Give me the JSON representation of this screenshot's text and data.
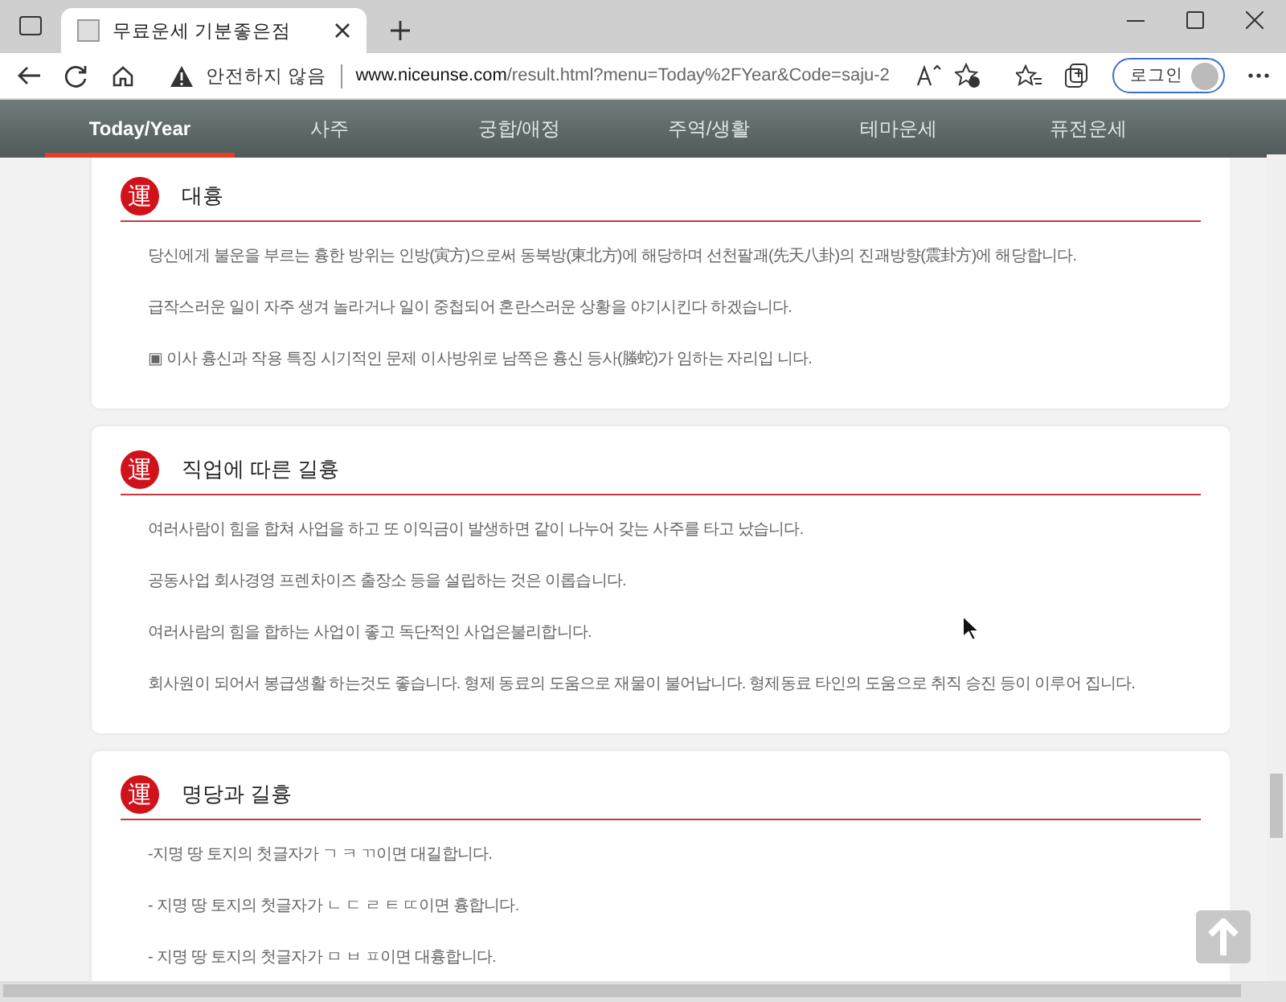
{
  "browser": {
    "tab_title": "무료운세 기분좋은점",
    "security_label": "안전하지 않음",
    "url_host": "www.niceunse.com",
    "url_path": "/result.html?menu=Today%2FYear&Code=saju-2",
    "login_label": "로그인"
  },
  "nav": [
    {
      "label": "Today/Year",
      "selected": true
    },
    {
      "label": "사주",
      "selected": false
    },
    {
      "label": "궁합/애정",
      "selected": false
    },
    {
      "label": "주역/생활",
      "selected": false
    },
    {
      "label": "테마운세",
      "selected": false
    },
    {
      "label": "퓨전운세",
      "selected": false
    }
  ],
  "sections": [
    {
      "badge": "運",
      "title": "대흉",
      "paragraphs": [
        "당신에게 불운을 부르는 흉한 방위는 인방(寅方)으로써 동북방(東北方)에 해당하며 선천팔괘(先天八卦)의 진괘방향(震卦方)에 해당합니다.",
        "급작스러운 일이 자주 생겨 놀라거나 일이 중첩되어 혼란스러운 상황을 야기시킨다 하겠습니다.",
        "▣ 이사 흉신과 작용 특징 시기적인 문제 이사방위로 남쪽은 흉신 등사(螣蛇)가 임하는 자리입 니다."
      ]
    },
    {
      "badge": "運",
      "title": "직업에 따른 길흉",
      "paragraphs": [
        "여러사람이 힘을 합쳐 사업을 하고 또 이익금이 발생하면 같이 나누어 갖는 사주를 타고 났습니다.",
        "공동사업 회사경영 프렌차이즈 출장소 등을 설립하는 것은 이롭습니다.",
        "여러사람의 힘을 합하는 사업이 좋고 독단적인 사업은불리합니다.",
        "회사원이 되어서 봉급생활 하는것도 좋습니다. 형제 동료의 도움으로 재물이 불어납니다. 형제동료 타인의 도움으로 취직 승진 등이 이루어 집니다."
      ]
    },
    {
      "badge": "運",
      "title": "명당과 길흉",
      "paragraphs": [
        "-지명 땅 토지의 첫글자가 ㄱ ㅋ ㄲ이면 대길합니다.",
        "- 지명 땅 토지의 첫글자가 ㄴ ㄷ ㄹ ㅌ ㄸ이면 흉합니다.",
        "- 지명 땅 토지의 첫글자가 ㅁ ㅂ ㅍ이면 대흉합니다."
      ]
    }
  ]
}
